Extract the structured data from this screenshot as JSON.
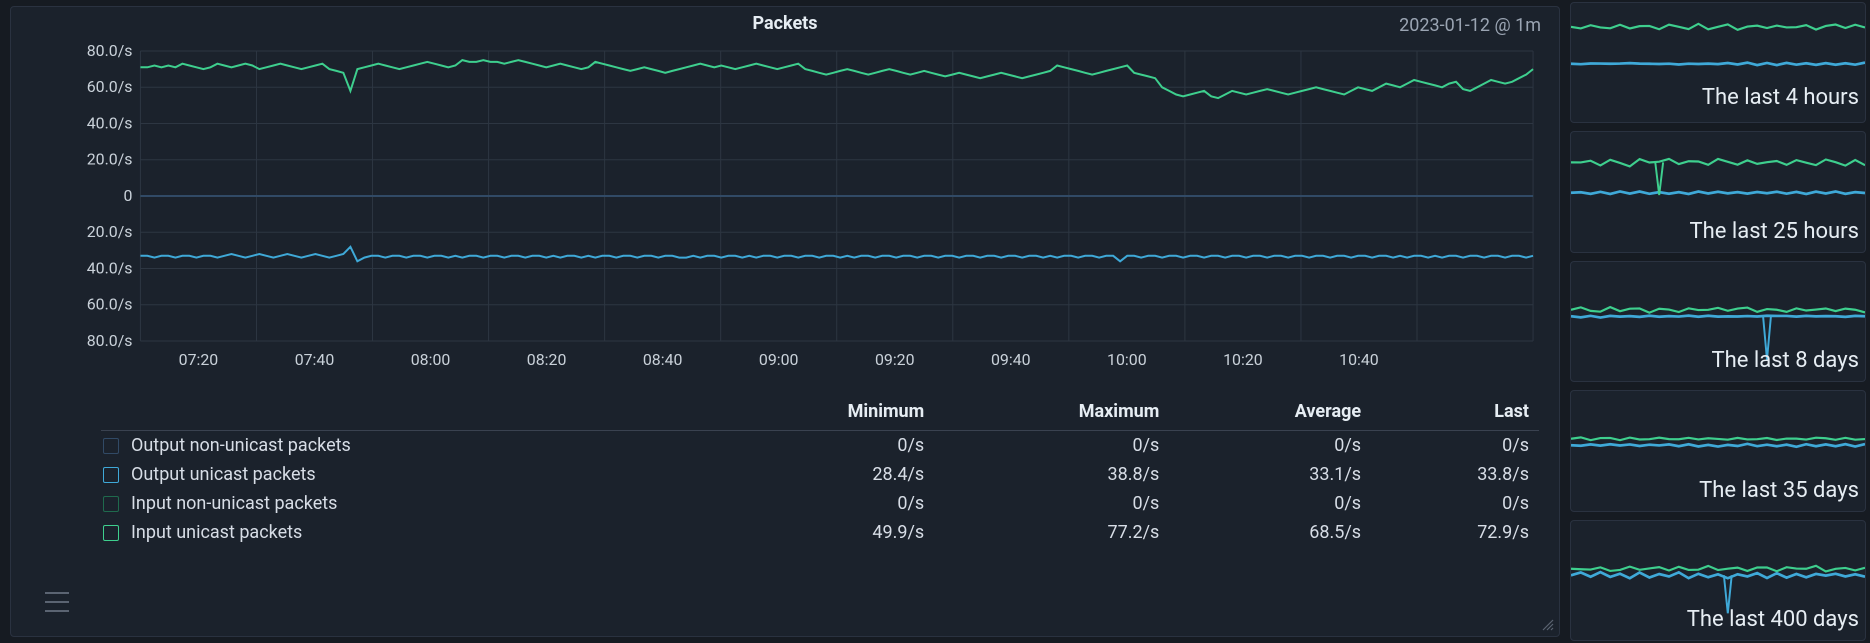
{
  "chart": {
    "title": "Packets",
    "timestamp": "2023-01-12 @ 1m"
  },
  "summary": {
    "headers": {
      "name": "",
      "min": "Minimum",
      "max": "Maximum",
      "avg": "Average",
      "last": "Last"
    },
    "rows": [
      {
        "name": "Output non-unicast packets",
        "min": "0/s",
        "max": "0/s",
        "avg": "0/s",
        "last": "0/s",
        "color": "#314a66",
        "fill": "#1b222c"
      },
      {
        "name": "Output unicast packets",
        "min": "28.4/s",
        "max": "38.8/s",
        "avg": "33.1/s",
        "last": "33.8/s",
        "color": "#3fa9d8",
        "fill": "#1b222c"
      },
      {
        "name": "Input non-unicast packets",
        "min": "0/s",
        "max": "0/s",
        "avg": "0/s",
        "last": "0/s",
        "color": "#1f6a4d",
        "fill": "#1b222c"
      },
      {
        "name": "Input unicast packets",
        "min": "49.9/s",
        "max": "77.2/s",
        "avg": "68.5/s",
        "last": "72.9/s",
        "color": "#3ecf8e",
        "fill": "#1b222c"
      }
    ]
  },
  "thumbs": [
    {
      "label": "The last 4 hours"
    },
    {
      "label": "The last 25 hours"
    },
    {
      "label": "The last 8 days"
    },
    {
      "label": "The last 35 days"
    },
    {
      "label": "The last 400 days"
    }
  ],
  "chart_data": {
    "type": "line",
    "title": "Packets",
    "xlabel": "",
    "ylabel": "",
    "y_axis": {
      "range_positive": [
        0,
        80
      ],
      "range_negative": [
        0,
        80
      ],
      "ticks_positive": [
        "0",
        "20.0/s",
        "40.0/s",
        "60.0/s",
        "80.0/s"
      ],
      "ticks_negative": [
        "20.0/s",
        "40.0/s",
        "60.0/s",
        "80.0/s"
      ]
    },
    "x_axis": {
      "ticks": [
        "07:20",
        "07:40",
        "08:00",
        "08:20",
        "08:40",
        "09:00",
        "09:20",
        "09:40",
        "10:00",
        "10:20",
        "10:40"
      ]
    },
    "mirrored": true,
    "legend_position": "bottom-table",
    "series": [
      {
        "name": "Input unicast packets",
        "direction": "positive",
        "color": "#3ecf8e",
        "values": [
          71,
          71,
          72,
          71,
          72,
          71,
          73,
          72,
          71,
          70,
          71,
          73,
          72,
          71,
          72,
          73,
          72,
          70,
          71,
          72,
          73,
          72,
          71,
          70,
          71,
          72,
          73,
          70,
          69,
          68,
          58,
          70,
          71,
          72,
          73,
          72,
          71,
          70,
          71,
          72,
          73,
          74,
          73,
          72,
          71,
          72,
          75,
          74,
          74,
          75,
          74,
          74,
          73,
          74,
          75,
          74,
          73,
          72,
          71,
          72,
          73,
          72,
          71,
          70,
          71,
          74,
          73,
          72,
          71,
          70,
          69,
          70,
          71,
          70,
          69,
          68,
          69,
          70,
          71,
          72,
          73,
          72,
          71,
          72,
          71,
          70,
          71,
          72,
          73,
          72,
          71,
          70,
          71,
          72,
          73,
          70,
          69,
          68,
          67,
          68,
          69,
          70,
          69,
          68,
          67,
          68,
          69,
          70,
          69,
          68,
          67,
          68,
          69,
          68,
          67,
          66,
          67,
          68,
          67,
          66,
          65,
          66,
          67,
          68,
          67,
          66,
          65,
          66,
          67,
          68,
          69,
          72,
          71,
          70,
          69,
          68,
          67,
          68,
          69,
          70,
          71,
          72,
          68,
          67,
          66,
          65,
          60,
          58,
          56,
          55,
          56,
          57,
          58,
          55,
          54,
          56,
          58,
          57,
          56,
          57,
          58,
          59,
          58,
          57,
          56,
          57,
          58,
          59,
          60,
          59,
          58,
          57,
          56,
          58,
          60,
          59,
          58,
          60,
          62,
          61,
          60,
          62,
          64,
          63,
          62,
          61,
          60,
          62,
          63,
          59,
          58,
          60,
          62,
          64,
          63,
          62,
          63,
          65,
          67,
          70
        ]
      },
      {
        "name": "Input non-unicast packets",
        "direction": "positive",
        "color": "#1f6a4d",
        "values": [
          0,
          0,
          0,
          0,
          0,
          0,
          0,
          0,
          0,
          0,
          0,
          0,
          0,
          0,
          0,
          0,
          0,
          0,
          0,
          0,
          0,
          0,
          0,
          0,
          0,
          0,
          0,
          0,
          0,
          0,
          0,
          0,
          0,
          0,
          0,
          0,
          0,
          0,
          0,
          0,
          0,
          0,
          0,
          0,
          0,
          0,
          0,
          0,
          0,
          0,
          0,
          0,
          0,
          0,
          0,
          0,
          0,
          0,
          0,
          0,
          0,
          0,
          0,
          0,
          0,
          0,
          0,
          0,
          0,
          0,
          0,
          0,
          0,
          0,
          0,
          0,
          0,
          0,
          0,
          0,
          0,
          0,
          0,
          0,
          0,
          0,
          0,
          0,
          0,
          0,
          0,
          0,
          0,
          0,
          0,
          0,
          0,
          0,
          0,
          0,
          0,
          0,
          0,
          0,
          0,
          0,
          0,
          0,
          0,
          0,
          0,
          0,
          0,
          0,
          0,
          0,
          0,
          0,
          0,
          0,
          0,
          0,
          0,
          0,
          0,
          0,
          0,
          0,
          0,
          0,
          0,
          0,
          0,
          0,
          0,
          0,
          0,
          0,
          0,
          0,
          0,
          0,
          0,
          0,
          0,
          0,
          0,
          0,
          0,
          0,
          0,
          0,
          0,
          0,
          0,
          0,
          0,
          0,
          0,
          0,
          0,
          0,
          0,
          0,
          0,
          0,
          0,
          0,
          0,
          0,
          0,
          0,
          0,
          0,
          0,
          0,
          0,
          0,
          0,
          0,
          0,
          0,
          0,
          0,
          0,
          0,
          0,
          0,
          0,
          0,
          0,
          0,
          0,
          0,
          0,
          0,
          0,
          0,
          0,
          0
        ]
      },
      {
        "name": "Output unicast packets",
        "direction": "negative",
        "color": "#3fa9d8",
        "values": [
          33,
          33,
          34,
          33,
          33,
          34,
          33,
          33,
          34,
          33,
          33,
          34,
          33,
          32,
          33,
          34,
          33,
          32,
          33,
          34,
          33,
          32,
          33,
          34,
          33,
          32,
          33,
          34,
          33,
          32,
          28,
          36,
          34,
          33,
          33,
          34,
          33,
          33,
          34,
          33,
          33,
          34,
          33,
          33,
          34,
          33,
          34,
          33,
          33,
          34,
          33,
          33,
          34,
          33,
          33,
          34,
          33,
          33,
          34,
          33,
          34,
          33,
          33,
          34,
          33,
          34,
          33,
          33,
          34,
          33,
          33,
          34,
          33,
          33,
          34,
          33,
          33,
          34,
          34,
          33,
          34,
          33,
          33,
          34,
          33,
          33,
          34,
          33,
          34,
          33,
          33,
          34,
          33,
          33,
          34,
          33,
          33,
          34,
          33,
          33,
          34,
          33,
          34,
          33,
          33,
          34,
          33,
          33,
          34,
          33,
          33,
          34,
          33,
          33,
          34,
          33,
          33,
          34,
          33,
          33,
          34,
          33,
          33,
          34,
          33,
          33,
          34,
          33,
          33,
          34,
          33,
          34,
          33,
          33,
          34,
          33,
          33,
          34,
          33,
          33,
          36,
          33,
          33,
          34,
          33,
          33,
          34,
          33,
          33,
          34,
          33,
          33,
          34,
          33,
          33,
          34,
          33,
          33,
          34,
          33,
          33,
          34,
          33,
          33,
          34,
          33,
          33,
          34,
          33,
          33,
          34,
          33,
          33,
          34,
          33,
          33,
          34,
          33,
          33,
          34,
          33,
          34,
          33,
          33,
          34,
          33,
          34,
          33,
          33,
          34,
          33,
          33,
          34,
          33,
          33,
          34,
          33,
          33,
          34,
          33
        ]
      },
      {
        "name": "Output non-unicast packets",
        "direction": "negative",
        "color": "#314a66",
        "values": [
          0,
          0,
          0,
          0,
          0,
          0,
          0,
          0,
          0,
          0,
          0,
          0,
          0,
          0,
          0,
          0,
          0,
          0,
          0,
          0,
          0,
          0,
          0,
          0,
          0,
          0,
          0,
          0,
          0,
          0,
          0,
          0,
          0,
          0,
          0,
          0,
          0,
          0,
          0,
          0,
          0,
          0,
          0,
          0,
          0,
          0,
          0,
          0,
          0,
          0,
          0,
          0,
          0,
          0,
          0,
          0,
          0,
          0,
          0,
          0,
          0,
          0,
          0,
          0,
          0,
          0,
          0,
          0,
          0,
          0,
          0,
          0,
          0,
          0,
          0,
          0,
          0,
          0,
          0,
          0,
          0,
          0,
          0,
          0,
          0,
          0,
          0,
          0,
          0,
          0,
          0,
          0,
          0,
          0,
          0,
          0,
          0,
          0,
          0,
          0,
          0,
          0,
          0,
          0,
          0,
          0,
          0,
          0,
          0,
          0,
          0,
          0,
          0,
          0,
          0,
          0,
          0,
          0,
          0,
          0,
          0,
          0,
          0,
          0,
          0,
          0,
          0,
          0,
          0,
          0,
          0,
          0,
          0,
          0,
          0,
          0,
          0,
          0,
          0,
          0,
          0,
          0,
          0,
          0,
          0,
          0,
          0,
          0,
          0,
          0,
          0,
          0,
          0,
          0,
          0,
          0,
          0,
          0,
          0,
          0,
          0,
          0,
          0,
          0,
          0,
          0,
          0,
          0,
          0,
          0,
          0,
          0,
          0,
          0,
          0,
          0,
          0,
          0,
          0,
          0,
          0,
          0,
          0,
          0,
          0,
          0,
          0,
          0,
          0,
          0,
          0,
          0,
          0,
          0,
          0,
          0,
          0,
          0,
          0,
          0
        ]
      }
    ]
  }
}
